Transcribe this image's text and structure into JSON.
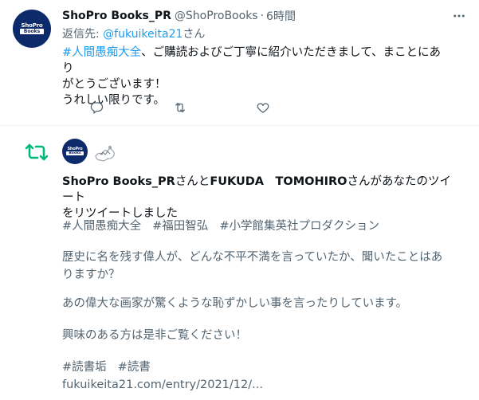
{
  "tweet": {
    "display_name": "ShoPro Books_PR",
    "handle": "@ShoProBooks",
    "separator": "·",
    "time": "6時間",
    "reply_prefix": "返信先: ",
    "reply_mention": "@fukuikeita21",
    "reply_suffix": "さん",
    "hashtag": "#人間愚痴大全",
    "line1": "、ご購読およびご丁寧に紹介いただきまして、まことにあり",
    "line2": "がとうございます！",
    "line3": "うれしい限りです。",
    "avatar_text_top": "ShoPro",
    "avatar_text_bottom": "Books"
  },
  "icons": {
    "more": "more-dots-icon",
    "reply": "reply-icon",
    "retweet": "retweet-icon",
    "like": "like-icon"
  },
  "notification": {
    "user1": "ShoPro Books_PR",
    "connector": "さんと",
    "user2": "FUKUDA　TOMOHIRO",
    "suffix_line1": "さんがあなたのツイート",
    "suffix_line2": "をリツイートしました"
  },
  "quoted": {
    "tags": [
      "#人間愚痴大全",
      "#福田智弘",
      "#小学館集英社プロダクション"
    ],
    "para1_line1": "歴史に名を残す偉人が、どんな不平不満を言っていたか、聞いたことはあ",
    "para1_line2": "りますか？",
    "para2": "あの偉大な画家が驚くような恥ずかしい事を言ったりしています。",
    "para3": "興味のある方は是非ご覧ください！",
    "tags2": [
      "#読書垢",
      "#読書"
    ],
    "link": "fukuikeita21.com/entry/2021/12/..."
  },
  "colors": {
    "accent": "#1d9bf0",
    "retweet_green": "#00ba7c",
    "muted": "#536471",
    "text": "#0f1419",
    "avatar_navy": "#0d2a6b"
  }
}
